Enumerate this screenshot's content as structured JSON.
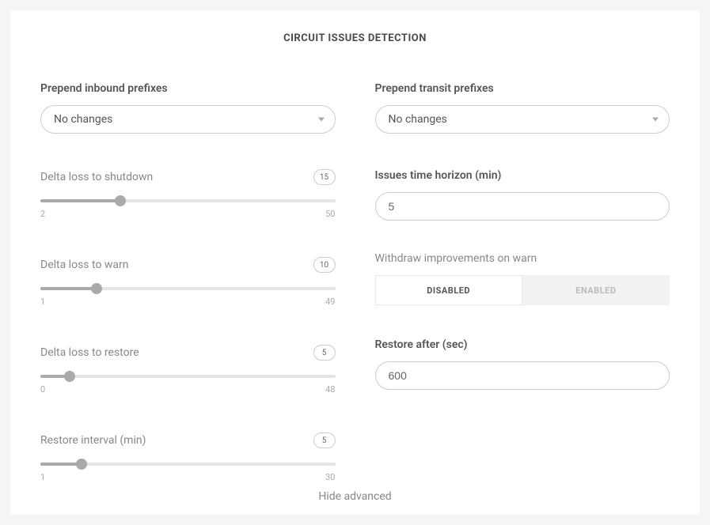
{
  "title": "CIRCUIT ISSUES DETECTION",
  "left": {
    "inbound": {
      "label": "Prepend inbound prefixes",
      "value": "No changes"
    },
    "sliders": {
      "shutdown": {
        "label": "Delta loss to shutdown",
        "value": "15",
        "min": "2",
        "max": "50",
        "pct": 27
      },
      "warn": {
        "label": "Delta loss to warn",
        "value": "10",
        "min": "1",
        "max": "49",
        "pct": 19
      },
      "restore": {
        "label": "Delta loss to restore",
        "value": "5",
        "min": "0",
        "max": "48",
        "pct": 10
      },
      "interval": {
        "label": "Restore interval (min)",
        "value": "5",
        "min": "1",
        "max": "30",
        "pct": 14
      }
    }
  },
  "right": {
    "transit": {
      "label": "Prepend transit prefixes",
      "value": "No changes"
    },
    "horizon": {
      "label": "Issues time horizon (min)",
      "value": "5"
    },
    "withdraw": {
      "label": "Withdraw improvements on warn",
      "disabled": "DISABLED",
      "enabled": "ENABLED"
    },
    "restore_after": {
      "label": "Restore after (sec)",
      "value": "600"
    }
  },
  "footer": {
    "hide_advanced": "Hide advanced"
  }
}
